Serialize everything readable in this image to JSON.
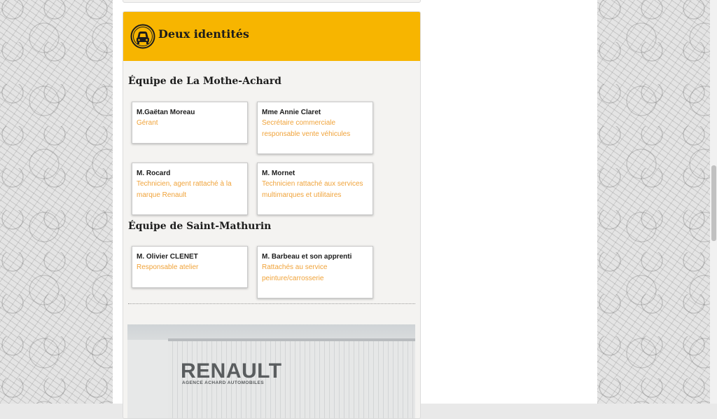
{
  "panel": {
    "title": "Deux identités",
    "header_color": "#f7b500",
    "icon": "car-front-icon"
  },
  "sections": [
    {
      "title": "Équipe de La Mothe-Achard",
      "members": [
        {
          "name": "M.Gaëtan Moreau",
          "role_line1": "Gérant",
          "role_line2": ""
        },
        {
          "name": "Mme Annie Claret",
          "role_line1": "Secrétaire commerciale",
          "role_line2": "responsable vente véhicules"
        },
        {
          "name": "M. Rocard",
          "role_line1": "Technicien, agent rattaché à la",
          "role_line2": "marque Renault"
        },
        {
          "name": "M. Mornet",
          "role_line1": "Technicien rattaché aux services",
          "role_line2": "multimarques et utilitaires"
        }
      ]
    },
    {
      "title": "Équipe de Saint-Mathurin",
      "members": [
        {
          "name": "M. Olivier CLENET",
          "role_line1": "Responsable atelier",
          "role_line2": ""
        },
        {
          "name": "M. Barbeau et son apprenti",
          "role_line1": "Rattachés au service",
          "role_line2": "peinture/carrosserie"
        }
      ]
    }
  ],
  "photo": {
    "brand": "RENAULT",
    "brand_sub": "AGENCE ACHARD AUTOMOBILES"
  },
  "colors": {
    "role_text": "#f0a33a",
    "accent": "#f7b500"
  }
}
